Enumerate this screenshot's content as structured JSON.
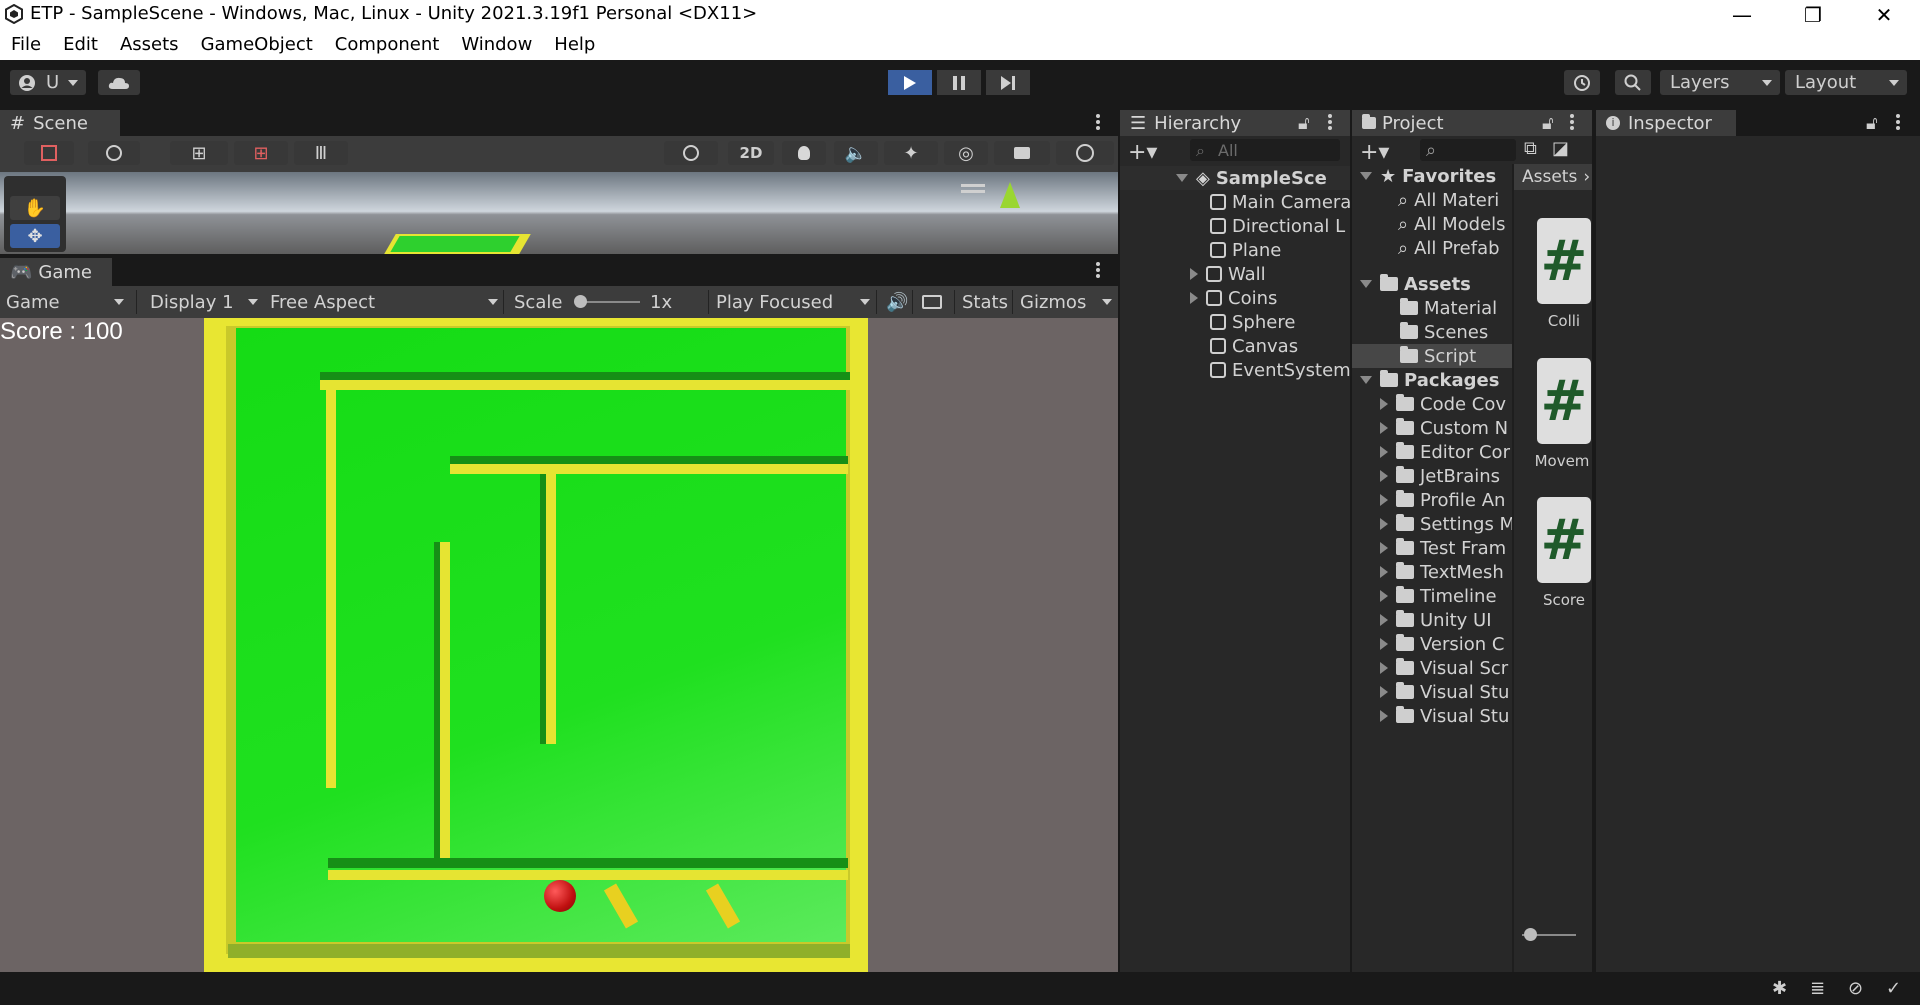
{
  "window": {
    "title": "ETP - SampleScene - Windows, Mac, Linux - Unity 2021.3.19f1 Personal <DX11>",
    "minimize": "—",
    "restore": "❐",
    "close": "✕"
  },
  "menu": [
    "File",
    "Edit",
    "Assets",
    "GameObject",
    "Component",
    "Window",
    "Help"
  ],
  "toolbar": {
    "account_label": "U",
    "layers_label": "Layers",
    "layout_label": "Layout"
  },
  "scene": {
    "tab_label": "Scene",
    "mode_2d": "2D"
  },
  "game": {
    "tab_label": "Game",
    "game_select": "Game",
    "display": "Display 1",
    "aspect": "Free Aspect",
    "scale_label": "Scale",
    "scale_value": "1x",
    "play_focused": "Play Focused",
    "stats": "Stats",
    "gizmos": "Gizmos",
    "score_text": "Score : 100"
  },
  "hierarchy": {
    "tab_label": "Hierarchy",
    "search_placeholder": "All",
    "scene_name": "SampleSce",
    "items": [
      "Main Camera",
      "Directional L",
      "Plane",
      "Wall",
      "Coins",
      "Sphere",
      "Canvas",
      "EventSystem"
    ]
  },
  "project": {
    "tab_label": "Project",
    "favorites_label": "Favorites",
    "favorites": [
      "All Materi",
      "All Models",
      "All Prefab"
    ],
    "assets_label": "Assets",
    "assets": [
      "Material",
      "Scenes",
      "Script"
    ],
    "packages_label": "Packages",
    "packages": [
      "Code Cov",
      "Custom N",
      "Editor Cor",
      "JetBrains",
      "Profile An",
      "Settings M",
      "Test Fram",
      "TextMesh",
      "Timeline",
      "Unity UI",
      "Version C",
      "Visual Scr",
      "Visual Stu",
      "Visual Stu"
    ],
    "breadcrumb": "Assets",
    "files": [
      "Colli",
      "Movem",
      "Score"
    ],
    "file_glyph": "#"
  },
  "inspector": {
    "tab_label": "Inspector"
  },
  "colors": {
    "floor": "#19e019",
    "wall": "#e8e632",
    "ball": "#d01818",
    "accent_blue": "#3a5fa0"
  }
}
